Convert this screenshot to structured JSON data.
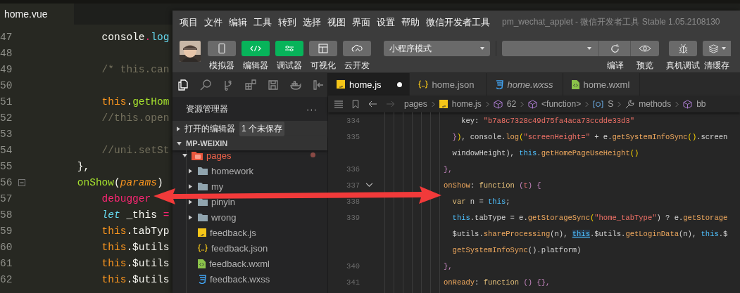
{
  "left_editor": {
    "tab": "home.vue",
    "lines": [
      {
        "number": "47",
        "fold": false,
        "tokens": [
          {
            "text": "        console",
            "kind": "plain"
          },
          {
            "text": ".",
            "kind": "op"
          },
          {
            "text": "log",
            "kind": "fn"
          }
        ]
      },
      {
        "number": "48",
        "fold": false
      },
      {
        "number": "49",
        "fold": false,
        "tokens": [
          {
            "text": "        /* this.can",
            "kind": "comment"
          }
        ]
      },
      {
        "number": "50",
        "fold": false
      },
      {
        "number": "51",
        "fold": false,
        "tokens": [
          {
            "text": "        this",
            "kind": "this"
          },
          {
            "text": ".",
            "kind": "plain"
          },
          {
            "text": "getHom",
            "kind": "method"
          }
        ]
      },
      {
        "number": "52",
        "fold": false,
        "tokens": [
          {
            "text": "        //this.open",
            "kind": "comment"
          }
        ]
      },
      {
        "number": "53",
        "fold": false
      },
      {
        "number": "54",
        "fold": false,
        "tokens": [
          {
            "text": "        //uni.setSt",
            "kind": "comment"
          }
        ]
      },
      {
        "number": "55",
        "fold": false,
        "tokens": [
          {
            "text": "    },",
            "kind": "plain"
          }
        ]
      },
      {
        "number": "56",
        "fold": true,
        "tokens": [
          {
            "text": "    onShow",
            "kind": "method"
          },
          {
            "text": "(",
            "kind": "plain"
          },
          {
            "text": "params",
            "kind": "param"
          },
          {
            "text": ")",
            "kind": "plain"
          }
        ]
      },
      {
        "number": "57",
        "fold": false,
        "tokens": [
          {
            "text": "        debugger",
            "kind": "keyword"
          }
        ]
      },
      {
        "number": "58",
        "fold": false,
        "tokens": [
          {
            "text": "        let",
            "kind": "storage"
          },
          {
            "text": " _this ",
            "kind": "plain"
          },
          {
            "text": "=",
            "kind": "op"
          }
        ]
      },
      {
        "number": "59",
        "fold": false,
        "tokens": [
          {
            "text": "        this",
            "kind": "this"
          },
          {
            "text": ".tabTyp",
            "kind": "plain"
          }
        ]
      },
      {
        "number": "60",
        "fold": false,
        "tokens": [
          {
            "text": "        this",
            "kind": "this"
          },
          {
            "text": ".$utils",
            "kind": "plain"
          }
        ]
      },
      {
        "number": "61",
        "fold": false,
        "tokens": [
          {
            "text": "        this",
            "kind": "this"
          },
          {
            "text": ".$utils",
            "kind": "plain"
          }
        ]
      },
      {
        "number": "62",
        "fold": false,
        "tokens": [
          {
            "text": "        this",
            "kind": "this"
          },
          {
            "text": ".$utils",
            "kind": "plain"
          }
        ]
      }
    ]
  },
  "devtools": {
    "menu": [
      "项目",
      "文件",
      "编辑",
      "工具",
      "转到",
      "选择",
      "视图",
      "界面",
      "设置",
      "帮助",
      "微信开发者工具"
    ],
    "title": "pm_wechat_applet - 微信开发者工具 Stable 1.05.2108130",
    "modes": [
      {
        "label": "模拟器",
        "selected": false
      },
      {
        "label": "编辑器",
        "selected": true
      },
      {
        "label": "调试器",
        "selected": true
      },
      {
        "label": "可视化",
        "selected": false
      },
      {
        "label": "云开发",
        "selected": false
      }
    ],
    "mode_select": "小程序模式",
    "actions": [
      {
        "label": "编译"
      },
      {
        "label": "预览"
      },
      {
        "label": "真机调试"
      },
      {
        "label": "清缓存"
      }
    ],
    "activity_bar": [
      {
        "selected": true
      },
      {
        "selected": false
      },
      {
        "selected": false
      },
      {
        "selected": false
      },
      {
        "selected": false
      },
      {
        "selected": false
      },
      {
        "selected": false
      }
    ],
    "sidebar": {
      "title": "资源管理器",
      "more": "···",
      "open_editors": "打开的编辑器",
      "unsaved_badge": "1 个未保存",
      "project": "MP-WEIXIN",
      "tree": [
        {
          "label": "pages",
          "kind": "folder",
          "expanded": true,
          "modified": true,
          "children": [
            {
              "label": "homework",
              "kind": "folder",
              "expanded": false,
              "modified": false
            },
            {
              "label": "my",
              "kind": "folder",
              "expanded": false,
              "modified": false
            },
            {
              "label": "pinyin",
              "kind": "folder",
              "expanded": false,
              "modified": false
            },
            {
              "label": "wrong",
              "kind": "folder",
              "expanded": false,
              "modified": false
            },
            {
              "label": "feedback.js",
              "kind": "js",
              "modified": false
            },
            {
              "label": "feedback.json",
              "kind": "json",
              "modified": false
            },
            {
              "label": "feedback.wxml",
              "kind": "wxml",
              "modified": false
            },
            {
              "label": "feedback.wxss",
              "kind": "wxss",
              "modified": false
            }
          ]
        }
      ]
    },
    "tabs": [
      {
        "label": "home.js",
        "kind": "js",
        "selected": true,
        "dirty": true,
        "preview": false
      },
      {
        "label": "home.json",
        "kind": "json",
        "selected": false,
        "dirty": false,
        "preview": false
      },
      {
        "label": "home.wxss",
        "kind": "wxss",
        "selected": false,
        "dirty": false,
        "preview": true
      },
      {
        "label": "home.wxml",
        "kind": "wxml",
        "selected": false,
        "dirty": false,
        "preview": false
      }
    ],
    "breadcrumb": [
      {
        "label": "pages",
        "kind": "folder"
      },
      {
        "label": "home.js",
        "kind": "js"
      },
      {
        "label": "62",
        "kind": "symbol"
      },
      {
        "label": "<function>",
        "kind": "symbol"
      },
      {
        "label": "S",
        "kind": "variable"
      },
      {
        "label": "methods",
        "kind": "method"
      },
      {
        "label": "bb",
        "kind": "symbol"
      }
    ],
    "code": [
      {
        "number": "334",
        "fold": false,
        "tokens": [
          {
            "text": "    key: ",
            "kind": "plain"
          },
          {
            "text": "\"b7a8c7328c49d75fa4aca73ccdde33d3\"",
            "kind": "str"
          }
        ]
      },
      {
        "number": "335",
        "fold": false,
        "tokens": [
          {
            "text": "  }",
            "kind": "brace"
          },
          {
            "text": ")",
            "kind": "paren"
          },
          {
            "text": ", console.",
            "kind": "plain"
          },
          {
            "text": "log",
            "kind": "fn"
          },
          {
            "text": "(",
            "kind": "paren"
          },
          {
            "text": "\"screenHeight=\"",
            "kind": "str"
          },
          {
            "text": " + e.",
            "kind": "plain"
          },
          {
            "text": "getSystemInfoSync",
            "kind": "fn"
          },
          {
            "text": "()",
            "kind": "paren"
          },
          {
            "text": ".screen",
            "kind": "plain"
          }
        ]
      },
      {
        "fold": false,
        "tokens": [
          {
            "text": "  windowHeight), ",
            "kind": "plain"
          },
          {
            "text": "this",
            "kind": "this"
          },
          {
            "text": ".",
            "kind": "plain"
          },
          {
            "text": "getHomePageUseHeight",
            "kind": "fn"
          },
          {
            "text": "()",
            "kind": "paren"
          }
        ]
      },
      {
        "number": "336",
        "fold": false,
        "tokens": [
          {
            "text": "},",
            "kind": "brace"
          }
        ]
      },
      {
        "number": "337",
        "fold": true,
        "tokens": [
          {
            "text": "onShow",
            "kind": "fn"
          },
          {
            "text": ": ",
            "kind": "plain"
          },
          {
            "text": "function",
            "kind": "keyword"
          },
          {
            "text": " (",
            "kind": "brace"
          },
          {
            "text": "t",
            "kind": "param"
          },
          {
            "text": ") {",
            "kind": "brace"
          }
        ]
      },
      {
        "number": "338",
        "fold": false,
        "tokens": [
          {
            "text": "  var",
            "kind": "keyword"
          },
          {
            "text": " n = ",
            "kind": "plain"
          },
          {
            "text": "this",
            "kind": "this"
          },
          {
            "text": ";",
            "kind": "plain"
          }
        ]
      },
      {
        "number": "339",
        "fold": false,
        "tokens": [
          {
            "text": "  this",
            "kind": "this"
          },
          {
            "text": ".tabType = e.",
            "kind": "plain"
          },
          {
            "text": "getStorageSync",
            "kind": "fn"
          },
          {
            "text": "(",
            "kind": "paren"
          },
          {
            "text": "\"home_tabType\"",
            "kind": "str"
          },
          {
            "text": ") ? e.",
            "kind": "plain"
          },
          {
            "text": "getStorage",
            "kind": "fn"
          }
        ]
      },
      {
        "fold": false,
        "tokens": [
          {
            "text": "  $utils.",
            "kind": "plain"
          },
          {
            "text": "shareProcessing",
            "kind": "fn"
          },
          {
            "text": "(n), ",
            "kind": "plain"
          },
          {
            "text": "this",
            "kind": "hl"
          },
          {
            "text": ".$utils.",
            "kind": "plain"
          },
          {
            "text": "getLoginData",
            "kind": "fn"
          },
          {
            "text": "(n), ",
            "kind": "plain"
          },
          {
            "text": "this",
            "kind": "this"
          },
          {
            "text": ".$",
            "kind": "plain"
          }
        ]
      },
      {
        "fold": false,
        "tokens": [
          {
            "text": "  getSystemInfoSync",
            "kind": "fn"
          },
          {
            "text": "().platform)",
            "kind": "plain"
          }
        ]
      },
      {
        "number": "340",
        "fold": false,
        "tokens": [
          {
            "text": "},",
            "kind": "brace"
          }
        ]
      },
      {
        "number": "341",
        "fold": false,
        "tokens": [
          {
            "text": "onReady",
            "kind": "fn"
          },
          {
            "text": ": ",
            "kind": "plain"
          },
          {
            "text": "function",
            "kind": "keyword"
          },
          {
            "text": " () {},",
            "kind": "brace"
          }
        ]
      }
    ]
  }
}
